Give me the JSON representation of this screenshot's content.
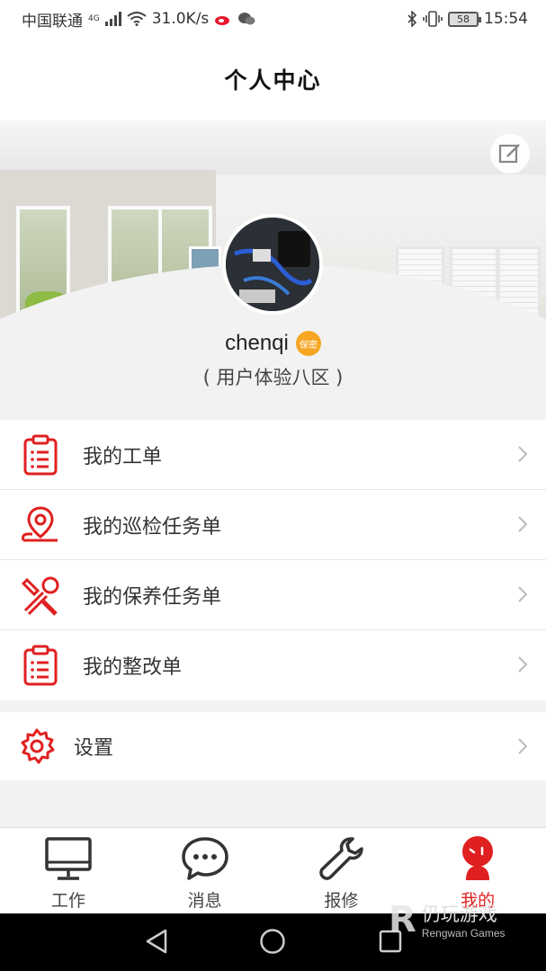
{
  "status_bar": {
    "carrier": "中国联通",
    "network": "4G",
    "speed": "31.0K/s",
    "battery": "58",
    "time": "15:54"
  },
  "header": {
    "title": "个人中心"
  },
  "profile": {
    "username": "chenqi",
    "badge": "保密",
    "region": "( 用户体验八区 )"
  },
  "menu": {
    "items": [
      {
        "label": "我的工单",
        "icon": "clipboard-icon"
      },
      {
        "label": "我的巡检任务单",
        "icon": "location-pin-icon"
      },
      {
        "label": "我的保养任务单",
        "icon": "tools-icon"
      },
      {
        "label": "我的整改单",
        "icon": "clipboard-icon"
      }
    ]
  },
  "settings": {
    "label": "设置",
    "icon": "gear-icon"
  },
  "tabbar": {
    "tabs": [
      {
        "label": "工作",
        "icon": "monitor-icon"
      },
      {
        "label": "消息",
        "icon": "chat-bubble-icon"
      },
      {
        "label": "报修",
        "icon": "wrench-icon"
      },
      {
        "label": "我的",
        "icon": "user-face-icon"
      }
    ],
    "active_index": 3
  },
  "watermark": {
    "cn": "仍玩游戏",
    "en": "Rengwan Games"
  },
  "colors": {
    "accent": "#e02020",
    "badge": "#f6a623",
    "background": "#f2f2f2"
  }
}
